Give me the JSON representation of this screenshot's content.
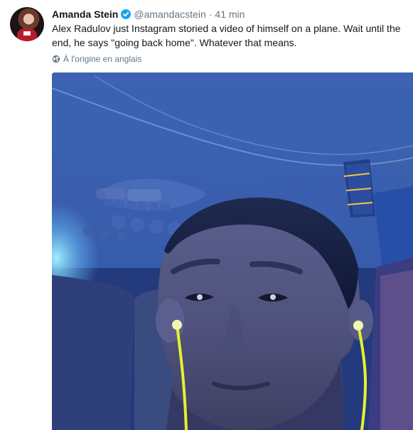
{
  "tweet": {
    "author_name": "Amanda Stein",
    "handle": "@amandacstein",
    "separator": "·",
    "time": "41 min",
    "text": "Alex Radulov just Instagram storied a video of himself on a plane. Wait until the end, he says \"going back home\". Whatever that means.",
    "translate_label": "À l'origine en anglais"
  },
  "icons": {
    "verified": "verified-badge-icon",
    "translate": "globe-icon"
  },
  "colors": {
    "name": "#14171a",
    "meta": "#657786",
    "verified": "#1da1f2",
    "cabin": "#3d66b4",
    "earbuds": "#e5f12d",
    "seat": "#1e3070"
  }
}
